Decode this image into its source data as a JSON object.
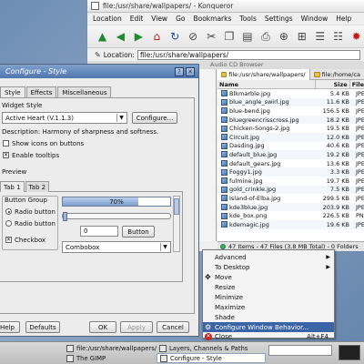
{
  "konqueror": {
    "title": "file:/usr/share/wallpapers/ - Konqueror",
    "menu": [
      "Location",
      "Edit",
      "View",
      "Go",
      "Bookmarks",
      "Tools",
      "Settings",
      "Window",
      "Help"
    ],
    "location_label": "Location:",
    "location_value": "file:/usr/share/wallpapers/",
    "bookmarks_hint": "Audio CD Browser",
    "tabs": [
      "file:/usr/share/wallpapers/",
      "file:/home/ca"
    ],
    "columns": {
      "name": "Name",
      "size": "Size",
      "type": "File"
    },
    "files": [
      {
        "name": "Blkmarble.jpg",
        "size": "5.4 KB",
        "type": "JPE"
      },
      {
        "name": "blue_angle_swirl.jpg",
        "size": "11.6 KB",
        "type": "JPE"
      },
      {
        "name": "blue-bend.jpg",
        "size": "156.5 KB",
        "type": "JPE"
      },
      {
        "name": "bluegreencrisscross.jpg",
        "size": "18.2 KB",
        "type": "JPE"
      },
      {
        "name": "Chicken-Songs-2.jpg",
        "size": "19.5 KB",
        "type": "JPE"
      },
      {
        "name": "Circuit.jpg",
        "size": "12.0 KB",
        "type": "JPE"
      },
      {
        "name": "Dasding.jpg",
        "size": "40.6 KB",
        "type": "JPE"
      },
      {
        "name": "default_blue.jpg",
        "size": "19.2 KB",
        "type": "JPE"
      },
      {
        "name": "default_gears.jpg",
        "size": "13.6 KB",
        "type": "JPE"
      },
      {
        "name": "Foggy1.jpg",
        "size": "3.3 KB",
        "type": "JPE"
      },
      {
        "name": "fulmine.jpg",
        "size": "19.7 KB",
        "type": "JPE"
      },
      {
        "name": "gold_crinkle.jpg",
        "size": "7.5 KB",
        "type": "JPE"
      },
      {
        "name": "Island-of-Elba.jpg",
        "size": "299.5 KB",
        "type": "JPE"
      },
      {
        "name": "kde3blue.jpg",
        "size": "203.9 KB",
        "type": "JPE"
      },
      {
        "name": "kde_box.png",
        "size": "226.5 KB",
        "type": "PNG"
      },
      {
        "name": "kdemagic.jpg",
        "size": "19.6 KB",
        "type": "JPE"
      }
    ],
    "status": "47 Items - 47 Files (3.8 MB Total) - 0 Folders"
  },
  "dialog": {
    "title": "Configure - Style",
    "tabs": [
      "Style",
      "Effects",
      "Miscellaneous"
    ],
    "widget_style_label": "Widget Style",
    "style_value": "Active Heart (V.1.1.3)",
    "configure_button": "Configure...",
    "description": "Description: Harmony of sharpness and softness.",
    "show_icons_label": "Show icons on buttons",
    "show_icons_checked": false,
    "tooltips_label": "Enable tooltips",
    "tooltips_checked": true,
    "preview_label": "Preview",
    "preview_tabs": [
      "Tab 1",
      "Tab 2"
    ],
    "button_group_label": "Button Group",
    "radio1": "Radio button",
    "radio2": "Radio button",
    "checkbox": "Checkbox",
    "progress_text": "70%",
    "progress_value": 0.7,
    "spin_value": "0",
    "button_label": "Button",
    "combobox_label": "Combobox",
    "buttons": {
      "help": "Help",
      "defaults": "Defaults",
      "ok": "OK",
      "apply": "Apply",
      "cancel": "Cancel"
    }
  },
  "context_menu": {
    "items": [
      {
        "label": "Advanced",
        "submenu": true
      },
      {
        "label": "To Desktop",
        "submenu": true
      },
      {
        "label": "Move"
      },
      {
        "label": "Resize"
      },
      {
        "label": "Minimize"
      },
      {
        "label": "Maximize"
      },
      {
        "label": "Shade"
      },
      {
        "label": "Configure Window Behavior...",
        "highlighted": true
      },
      {
        "label": "Close",
        "shortcut": "Alt+F4"
      }
    ]
  },
  "taskbar": {
    "tasks": [
      {
        "label": "file:/usr/share/wallpapers/ - K"
      },
      {
        "label": "The GIMP"
      },
      {
        "label": "Layers, Channels & Paths"
      },
      {
        "label": "Configure - Style",
        "active": true
      }
    ]
  },
  "colors": {
    "accent": "#3b64a6",
    "title_bar": "#5c82b8"
  }
}
